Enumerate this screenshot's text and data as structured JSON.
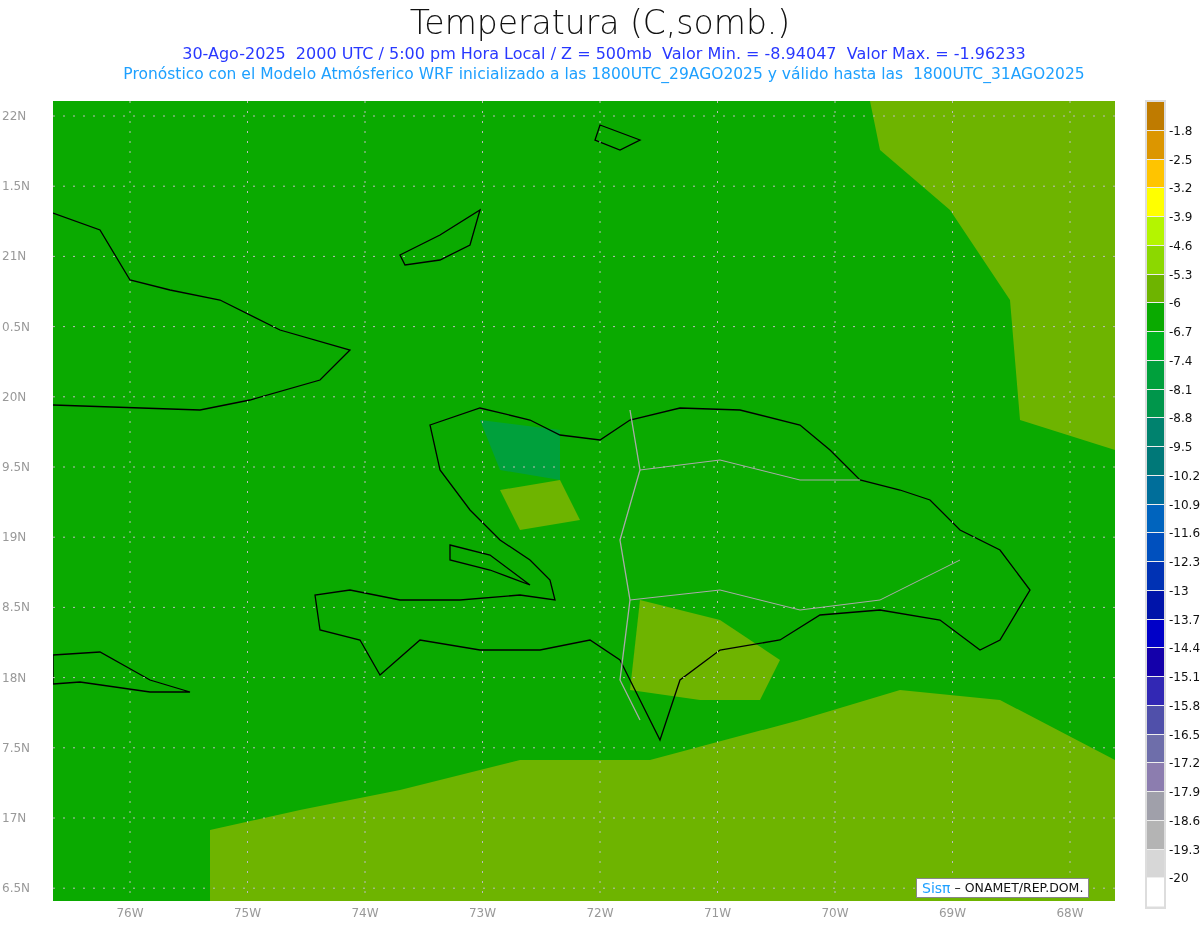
{
  "title": "Temperatura (C,somb.)",
  "subtitle": "30-Ago-2025  2000 UTC / 5:00 pm Hora Local / Z = 500mb  Valor Min. = -8.94047  Valor Max. = -1.96233",
  "forecast_note": "Pronóstico con el Modelo Atmósferico WRF inicializado a las 1800UTC_29AGO2025 y válido hasta las  1800UTC_31AGO2025",
  "y_axis": [
    "22N",
    "1.5N",
    "21N",
    "0.5N",
    "20N",
    "9.5N",
    "19N",
    "8.5N",
    "18N",
    "7.5N",
    "17N",
    "6.5N"
  ],
  "x_axis": [
    "76W",
    "75W",
    "74W",
    "73W",
    "72W",
    "71W",
    "70W",
    "69W",
    "68W"
  ],
  "legend": {
    "colors": [
      {
        "color": "#bf7b00"
      },
      {
        "color": "#dc9600"
      },
      {
        "color": "#ffc400"
      },
      {
        "color": "#ffff00"
      },
      {
        "color": "#b4f500"
      },
      {
        "color": "#8cd800"
      },
      {
        "color": "#6eb400"
      },
      {
        "color": "#0aaa00"
      },
      {
        "color": "#00b41e"
      },
      {
        "color": "#00a03c"
      },
      {
        "color": "#00964b"
      },
      {
        "color": "#00826e"
      },
      {
        "color": "#007878"
      },
      {
        "color": "#006e9a"
      },
      {
        "color": "#0064be"
      },
      {
        "color": "#0050be"
      },
      {
        "color": "#0032b4"
      },
      {
        "color": "#0014aa"
      },
      {
        "color": "#0000c8"
      },
      {
        "color": "#1400aa"
      },
      {
        "color": "#3228b4"
      },
      {
        "color": "#5050aa"
      },
      {
        "color": "#6e6eaa"
      },
      {
        "color": "#8c7daf"
      },
      {
        "color": "#a0a0aa"
      },
      {
        "color": "#b4b4b4"
      },
      {
        "color": "#d7d7d7"
      },
      {
        "color": "#ffffff"
      }
    ],
    "labels": [
      "-1.8",
      "-2.5",
      "-3.2",
      "-3.9",
      "-4.6",
      "-5.3",
      "-6",
      "-6.7",
      "-7.4",
      "-8.1",
      "-8.8",
      "-9.5",
      "-10.2",
      "-10.9",
      "-11.6",
      "-12.3",
      "-13",
      "-13.7",
      "-14.4",
      "-15.1",
      "-15.8",
      "-16.5",
      "-17.2",
      "-17.9",
      "-18.6",
      "-19.3",
      "-20"
    ]
  },
  "credit": {
    "logo": "Sisπ",
    "text": "– ONAMET/REP.DOM."
  }
}
